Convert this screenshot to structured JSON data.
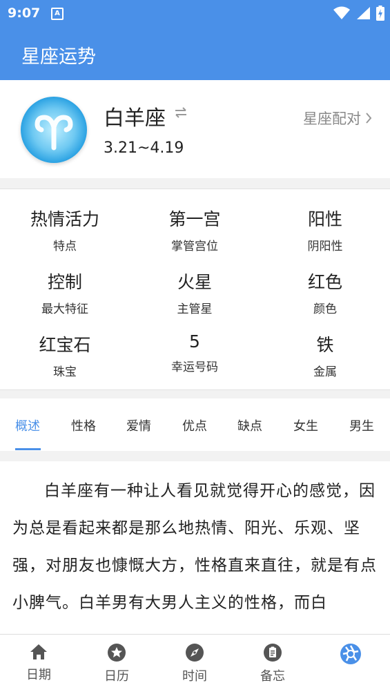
{
  "status_bar": {
    "time": "9:07",
    "notification_icon": "A"
  },
  "app_bar": {
    "title": "星座运势"
  },
  "sign": {
    "name": "白羊座",
    "dates": "3.21~4.19",
    "pair_link": "星座配对",
    "logo_icon": "aries-icon",
    "swap_icon": "swap-icon"
  },
  "attributes": [
    {
      "value": "热情活力",
      "label": "特点"
    },
    {
      "value": "第一宫",
      "label": "掌管宫位"
    },
    {
      "value": "阳性",
      "label": "阴阳性"
    },
    {
      "value": "控制",
      "label": "最大特征"
    },
    {
      "value": "火星",
      "label": "主管星"
    },
    {
      "value": "红色",
      "label": "颜色"
    },
    {
      "value": "红宝石",
      "label": "珠宝"
    },
    {
      "value": "5",
      "label": "幸运号码"
    },
    {
      "value": "铁",
      "label": "金属"
    }
  ],
  "tabs": [
    {
      "label": "概述",
      "active": true
    },
    {
      "label": "性格",
      "active": false
    },
    {
      "label": "爱情",
      "active": false
    },
    {
      "label": "优点",
      "active": false
    },
    {
      "label": "缺点",
      "active": false
    },
    {
      "label": "女生",
      "active": false
    },
    {
      "label": "男生",
      "active": false
    }
  ],
  "content": {
    "text": "白羊座有一种让人看见就觉得开心的感觉，因为总是看起来都是那么地热情、阳光、乐观、坚强，对朋友也慷慨大方，性格直来直往，就是有点小脾气。白羊男有大男人主义的性格，而白"
  },
  "bottom_nav": [
    {
      "label": "日期",
      "icon": "home-icon"
    },
    {
      "label": "日历",
      "icon": "star-icon"
    },
    {
      "label": "时间",
      "icon": "compass-icon"
    },
    {
      "label": "备忘",
      "icon": "clipboard-icon"
    },
    {
      "label": "",
      "icon": "shutter-icon",
      "active": true
    }
  ],
  "colors": {
    "primary": "#4a90e8",
    "background": "#f2f2f2"
  }
}
